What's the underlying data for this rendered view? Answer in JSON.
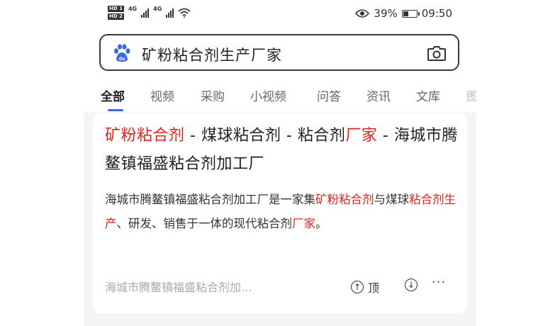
{
  "status_bar": {
    "sim1": "HD 1",
    "sim2": "HD 2",
    "network1": "4G",
    "network2": "4G",
    "battery_percent": "39%",
    "battery_level": 0.39,
    "time": "09:50"
  },
  "search": {
    "query": "矿粉粘合剂生产厂家",
    "logo_icon": "baidu-paw-icon",
    "camera_icon": "camera-icon"
  },
  "tabs": [
    {
      "label": "全部",
      "active": true
    },
    {
      "label": "视频"
    },
    {
      "label": "采购"
    },
    {
      "label": "小视频"
    },
    {
      "label": "问答"
    },
    {
      "label": "资讯"
    },
    {
      "label": "文库"
    },
    {
      "label": "图"
    }
  ],
  "result": {
    "title_parts": [
      {
        "text": "矿粉粘合剂",
        "highlight": true
      },
      {
        "text": " - 煤球粘合剂 - 粘合剂",
        "highlight": false
      },
      {
        "text": "厂家",
        "highlight": true
      },
      {
        "text": " - 海城市腾鳌镇福盛粘合剂加工厂",
        "highlight": false
      }
    ],
    "snippet_parts": [
      {
        "text": "海城市腾鳌镇福盛粘合剂加工厂是一家集",
        "highlight": false
      },
      {
        "text": "矿粉粘合剂",
        "highlight": true
      },
      {
        "text": "与煤球",
        "highlight": false
      },
      {
        "text": "粘合剂生产",
        "highlight": true
      },
      {
        "text": "、研发、销售于一体的现代粘合剂",
        "highlight": false
      },
      {
        "text": "厂家",
        "highlight": true
      },
      {
        "text": "。",
        "highlight": false
      }
    ],
    "source": "海城市腾鳌镇福盛粘合剂加...",
    "upvote_label": "顶",
    "more_label": "···"
  },
  "colors": {
    "highlight": "#e0241b",
    "tab_indicator": "#3a68e8",
    "baidu_blue": "#3a68e8"
  }
}
